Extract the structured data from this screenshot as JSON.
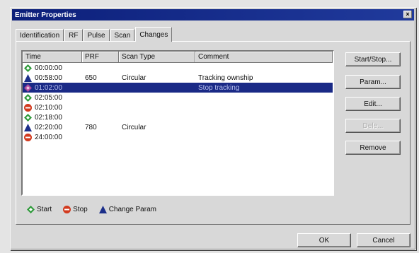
{
  "window": {
    "title": "Emitter Properties",
    "close_glyph": "×"
  },
  "tabs": [
    {
      "label": "Identification"
    },
    {
      "label": "RF"
    },
    {
      "label": "Pulse"
    },
    {
      "label": "Scan"
    },
    {
      "label": "Changes",
      "active": true
    }
  ],
  "list": {
    "columns": [
      "Time",
      "PRF",
      "Scan Type",
      "Comment"
    ],
    "rows": [
      {
        "icon": "start",
        "time": "00:00:00",
        "prf": "",
        "scan_type": "",
        "comment": ""
      },
      {
        "icon": "change",
        "time": "00:58:00",
        "prf": "650",
        "scan_type": "Circular",
        "comment": "Tracking ownship"
      },
      {
        "icon": "pending",
        "time": "01:02:00",
        "prf": "",
        "scan_type": "",
        "comment": "Stop tracking",
        "selected": true
      },
      {
        "icon": "start",
        "time": "02:05:00",
        "prf": "",
        "scan_type": "",
        "comment": ""
      },
      {
        "icon": "stop",
        "time": "02:10:00",
        "prf": "",
        "scan_type": "",
        "comment": ""
      },
      {
        "icon": "start",
        "time": "02:18:00",
        "prf": "",
        "scan_type": "",
        "comment": ""
      },
      {
        "icon": "change",
        "time": "02:20:00",
        "prf": "780",
        "scan_type": "Circular",
        "comment": ""
      },
      {
        "icon": "stop",
        "time": "24:00:00",
        "prf": "",
        "scan_type": "",
        "comment": ""
      }
    ]
  },
  "legend": {
    "start_label": "Start",
    "stop_label": "Stop",
    "change_label": "Change Param"
  },
  "buttons": {
    "startstop": "Start/Stop...",
    "param": "Param...",
    "edit": "Edit...",
    "disabled": "Dele...",
    "remove": "Remove",
    "ok": "OK",
    "cancel": "Cancel"
  },
  "colors": {
    "title_bar": "#0c1f7a",
    "selection": "#1a2a86",
    "start_icon": "#2e9a3a",
    "stop_icon": "#d23a1e",
    "change_icon": "#1c2f8a",
    "pending_icon": "#b04aa0"
  }
}
